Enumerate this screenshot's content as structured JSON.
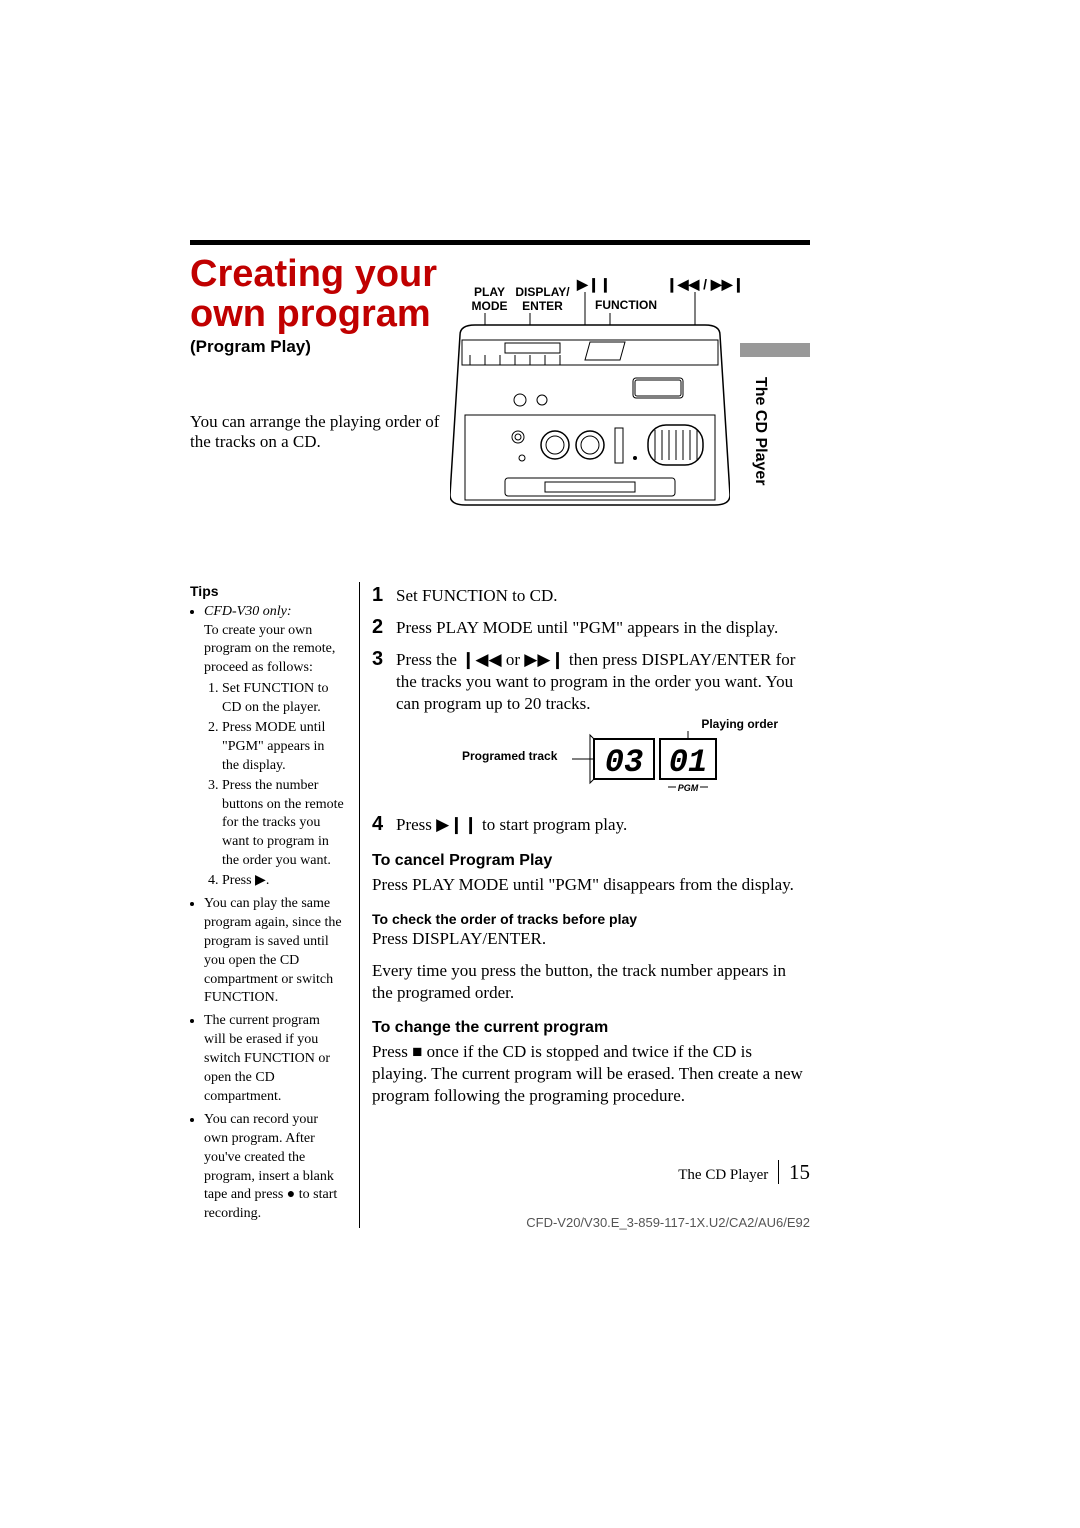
{
  "header": {
    "title_line1": "Creating your",
    "title_line2": "own program",
    "subtitle": "(Program Play)",
    "intro": "You can arrange the playing order of the tracks on a CD."
  },
  "side_tab": "The CD Player",
  "diagram_labels": {
    "play_mode": "PLAY MODE",
    "display_enter": "DISPLAY/ ENTER",
    "function": "FUNCTION",
    "play_pause_icon": "▶❙❙",
    "prev_next_icon": "❙◀◀ / ▶▶❙"
  },
  "tips": {
    "heading": "Tips",
    "model_note": "CFD-V30 only:",
    "model_intro": "To create your own program on the remote, proceed as follows:",
    "model_steps": [
      "Set FUNCTION to CD on the player.",
      "Press MODE until \"PGM\" appears in the display.",
      "Press the number buttons on the remote for the tracks you want to program in the order you want.",
      "Press ▶."
    ],
    "bullets": [
      "You can play the same program again, since the program is saved until you open the CD compartment or switch FUNCTION.",
      "The current program will be erased if you switch FUNCTION or open the CD compartment.",
      "You can record your own program. After you've created the program, insert a blank tape and press ● to start recording."
    ]
  },
  "steps": {
    "s1": "Set FUNCTION to CD.",
    "s2": "Press PLAY MODE until \"PGM\" appears in the display.",
    "s3a": "Press the ",
    "s3_prev": "❙◀◀",
    "s3b": " or ",
    "s3_next": "▶▶❙",
    "s3c": " then press DISPLAY/ENTER for the tracks you want to program in the order you want. You can program up to 20 tracks.",
    "s4a": "Press ",
    "s4_icon": "▶❙❙",
    "s4b": " to start program play."
  },
  "lcd": {
    "programed_track_label": "Programed track",
    "playing_order_label": "Playing order",
    "track_value": "03",
    "order_value": "01",
    "pgm_indicator": "PGM"
  },
  "sections": {
    "cancel_h": "To cancel Program Play",
    "cancel_b": "Press PLAY MODE until \"PGM\" disappears from the display.",
    "check_h": "To check the order of tracks before play",
    "check_b1": "Press DISPLAY/ENTER.",
    "check_b2": "Every time you press the button, the track number appears in the programed order.",
    "change_h": "To change the current program",
    "change_b": "Press ■ once if the CD is stopped and twice if the CD is playing. The current program will be erased. Then create a new program following the programing procedure."
  },
  "footer": {
    "section": "The CD Player",
    "page": "15",
    "doc_id": "CFD-V20/V30.E_3-859-117-1X.U2/CA2/AU6/E92"
  }
}
